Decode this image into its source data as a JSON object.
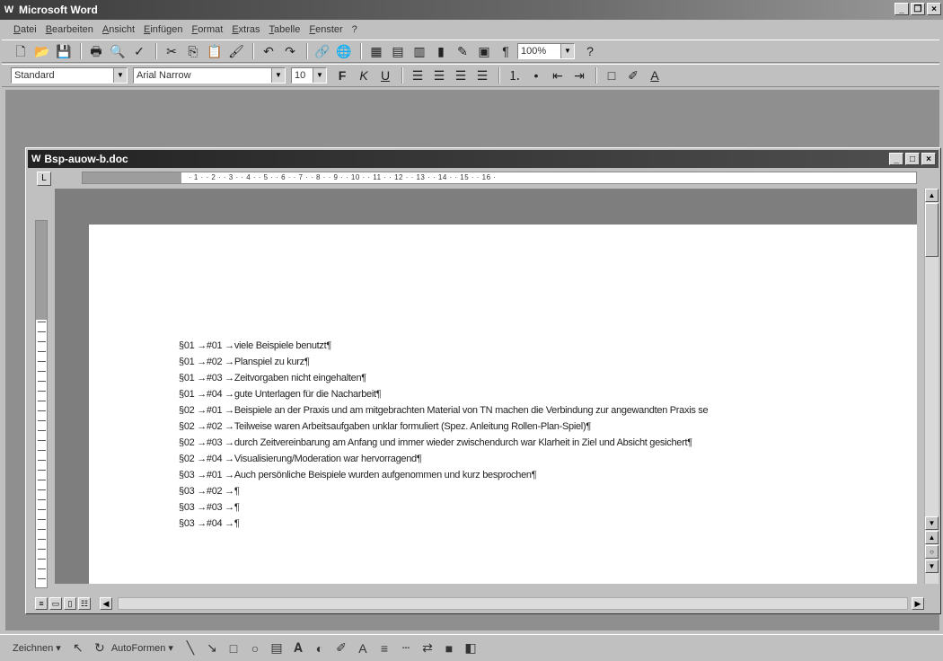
{
  "app": {
    "title": "Microsoft Word",
    "icon": "word-icon"
  },
  "menu": [
    "Datei",
    "Bearbeiten",
    "Ansicht",
    "Einfügen",
    "Format",
    "Extras",
    "Tabelle",
    "Fenster",
    "?"
  ],
  "toolbar": {
    "style": "Standard",
    "font": "Arial Narrow",
    "size": "10",
    "zoom": "100%"
  },
  "document": {
    "title": "Bsp-auow-b.doc",
    "ruler_numbers": "· 1 · · 2 · · 3 · · 4 · · 5 · · 6 · · 7 · · 8 · · 9 · · 10 · · 11 · · 12 · · 13 · · 14 · · 15 · · 16 ·",
    "lines": [
      "§01 →#01 →viele Beispiele benutzt¶",
      "§01 →#02 →Planspiel zu kurz¶",
      "§01 →#03 →Zeitvorgaben nicht eingehalten¶",
      "§01 →#04 →gute Unterlagen für die Nacharbeit¶",
      "§02 →#01 →Beispiele an der Praxis und am mitgebrachten Material von TN machen die Verbindung zur angewandten Praxis se",
      "§02 →#02 →Teilweise waren Arbeitsaufgaben unklar formuliert (Spez. Anleitung Rollen-Plan-Spiel)¶",
      "§02 →#03 →durch Zeitvereinbarung am Anfang und immer wieder zwischendurch war Klarheit in Ziel und Absicht gesichert¶",
      "§02 →#04 →Visualisierung/Moderation war hervorragend¶",
      "§03 →#01 →Auch persönliche Beispiele wurden aufgenommen und kurz besprochen¶",
      "§03 →#02 →¶",
      "§03 →#03 →¶",
      "§03 →#04 →¶"
    ]
  },
  "drawbar": {
    "zeichnen": "Zeichnen ▾",
    "autoformen": "AutoFormen ▾"
  }
}
